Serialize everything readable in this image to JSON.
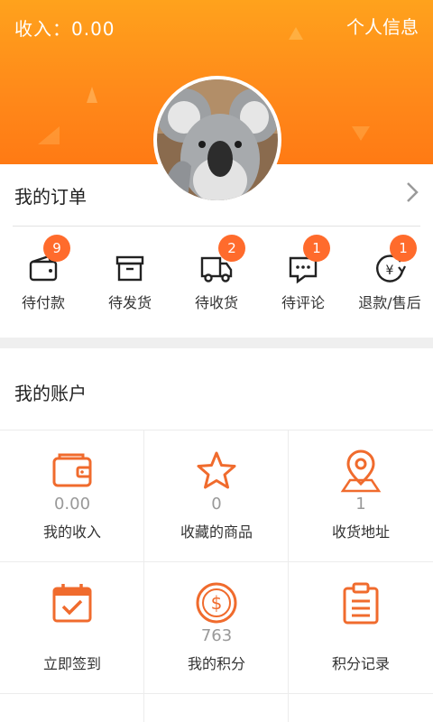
{
  "header": {
    "income_label": "收入：0.00",
    "profile_link": "个人信息"
  },
  "orders": {
    "title": "我的订单",
    "items": [
      {
        "label": "待付款",
        "badge": "9",
        "icon": "wallet-icon"
      },
      {
        "label": "待发货",
        "badge": "",
        "icon": "box-icon"
      },
      {
        "label": "待收货",
        "badge": "2",
        "icon": "truck-icon"
      },
      {
        "label": "待评论",
        "badge": "1",
        "icon": "comment-icon"
      },
      {
        "label": "退款/售后",
        "badge": "1",
        "icon": "refund-icon"
      }
    ]
  },
  "account": {
    "title": "我的账户",
    "cells": [
      {
        "value": "0.00",
        "label": "我的收入",
        "icon": "wallet-icon"
      },
      {
        "value": "0",
        "label": "收藏的商品",
        "icon": "star-icon"
      },
      {
        "value": "1",
        "label": "收货地址",
        "icon": "location-pin-icon"
      },
      {
        "value": "",
        "label": "立即签到",
        "icon": "calendar-check-icon"
      },
      {
        "value": "763",
        "label": "我的积分",
        "icon": "dollar-coin-icon"
      },
      {
        "value": "",
        "label": "积分记录",
        "icon": "clipboard-icon"
      }
    ]
  },
  "colors": {
    "header_top": "#ffa21c",
    "header_bottom": "#ff7a14",
    "accent": "#f06b2d",
    "badge": "#ff6b2c"
  }
}
